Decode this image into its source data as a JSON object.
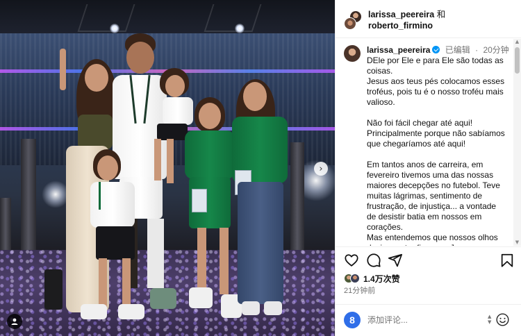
{
  "post": {
    "header": {
      "user1": "larissa_peereira",
      "conjunction": "和",
      "user2": "roberto_firmino"
    },
    "caption": {
      "username": "larissa_peereira",
      "edited_label": "已编辑",
      "separator": "·",
      "time": "20分钟",
      "lines": [
        "DEle por Ele e para Ele são todas as",
        "coisas.",
        "Jesus aos teus pés colocamos esses",
        "troféus, pois tu é o nosso troféu mais",
        "valioso.",
        "",
        "Não foi fácil chegar até aqui!",
        "Principalmente porque não sabíamos",
        "que chegaríamos até aqui!",
        "",
        "Em tantos anos de carreira, em",
        "fevereiro tivemos uma das nossas",
        "maiores decepções no futebol. Teve",
        "muitas lágrimas, sentimento de",
        "frustração, de injustiça... a vontade",
        "de desistir batia em nossos em",
        "corações.",
        "Mas entendemos que nossos olhos",
        "deviam estar fixos em Jesus e no"
      ]
    },
    "likes": "1.4万次赞",
    "timestamp": "21分钟前",
    "comment": {
      "placeholder": "添加评论...",
      "grammarly_letter": "8"
    }
  },
  "icons": {
    "like": "heart-icon",
    "comment": "comment-icon",
    "share": "send-icon",
    "save": "bookmark-icon",
    "next": "chevron-right-icon",
    "tags": "user-tag-icon",
    "emoji": "smiley-icon",
    "verified": "verified-badge-icon"
  },
  "photo": {
    "nav_arrow_glyph": "›"
  },
  "colors": {
    "verified_blue": "#0095f6",
    "secondary_text": "#737373",
    "jersey_green": "#16874a",
    "grammarly_blue": "#2f6ee8"
  }
}
